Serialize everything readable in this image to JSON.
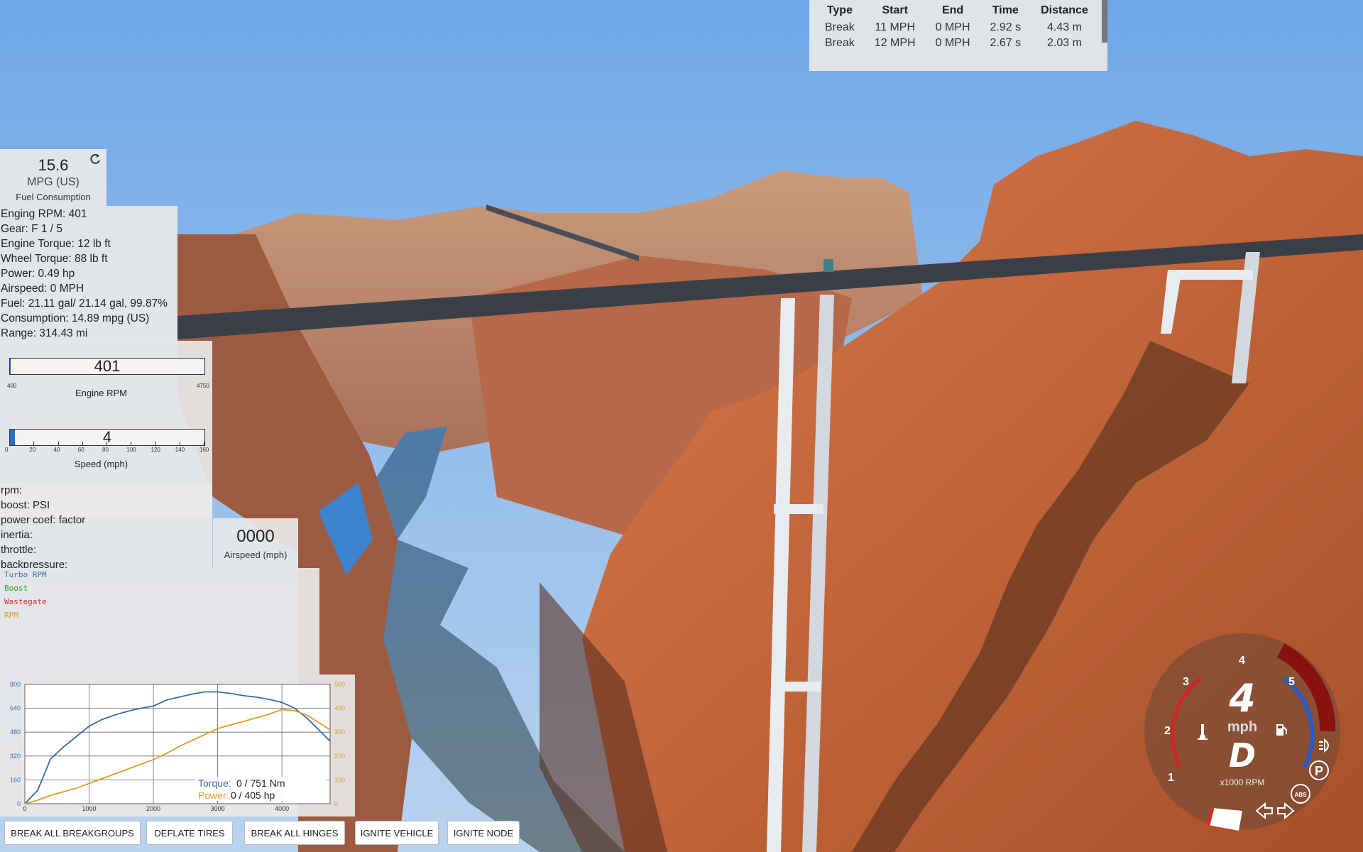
{
  "colors": {
    "sky": "#7fb5ec",
    "rock": "#c9683a",
    "road": "#3a3f47",
    "pillar": "#e8ecef",
    "water": "#4f6e85",
    "accent_blue": "#2a6fc2",
    "torque_line": "#3a6aa8",
    "power_line": "#e39a24"
  },
  "brake_table": {
    "headers": [
      "Type",
      "Start",
      "End",
      "Time",
      "Distance"
    ],
    "rows": [
      [
        "Break",
        "11 MPH",
        "0 MPH",
        "2.92 s",
        "4.43 m"
      ],
      [
        "Break",
        "12 MPH",
        "0 MPH",
        "2.67 s",
        "2.03 m"
      ]
    ]
  },
  "fuel": {
    "value": "15.6",
    "unit": "MPG (US)",
    "label": "Fuel Consumption",
    "refresh_icon": "refresh-icon"
  },
  "stats": [
    "Enging RPM: 401",
    "Gear: F 1 / 5",
    "Engine Torque: 12 lb ft",
    "Wheel Torque: 88 lb ft",
    "Power: 0.49 hp",
    "Airspeed: 0 MPH",
    "Fuel: 21.11 gal/ 21.14 gal, 99.87%",
    "Consumption: 14.89 mpg (US)",
    "Range: 314.43 mi"
  ],
  "rpm_gauge": {
    "value": "401",
    "min": "400",
    "max": "4750",
    "label": "Engine RPM",
    "fill": 0.001
  },
  "speed_gauge": {
    "value": "4",
    "label": "Speed (mph)",
    "ticks": [
      "0",
      "20",
      "40",
      "60",
      "80",
      "100",
      "120",
      "140",
      "160"
    ],
    "fill": 0.025
  },
  "turbo": [
    "rpm:",
    "boost: PSI",
    "power coef: factor",
    "inertia:",
    "throttle:",
    "backpressure:"
  ],
  "airspeed": {
    "value": "0000",
    "label": "Airspeed (mph)"
  },
  "turbo_legend": [
    {
      "name": "Turbo RPM",
      "color": "#3a6aa8"
    },
    {
      "name": "Boost",
      "color": "#2fa82f"
    },
    {
      "name": "Wastegate",
      "color": "#d62c2c"
    },
    {
      "name": "RPM",
      "color": "#e39a24"
    }
  ],
  "chart_data": {
    "type": "line",
    "x": [
      0,
      200,
      400,
      600,
      800,
      1000,
      1200,
      1400,
      1600,
      1800,
      2000,
      2200,
      2400,
      2600,
      2800,
      3000,
      3200,
      3400,
      3600,
      3800,
      4000,
      4200,
      4400,
      4750
    ],
    "xlim": [
      0,
      4750
    ],
    "x_ticks": [
      "0",
      "1000",
      "2000",
      "3000",
      "4000"
    ],
    "y_left_ticks": [
      "0",
      "160",
      "320",
      "480",
      "640",
      "800"
    ],
    "y_right_ticks": [
      "0",
      "100",
      "200",
      "300",
      "400",
      "500"
    ],
    "ylim_left": [
      0,
      800
    ],
    "ylim_right": [
      0,
      500
    ],
    "grid": true,
    "series": [
      {
        "name": "Torque",
        "axis": "left",
        "color": "#3a6aa8",
        "values": [
          0,
          90,
          300,
          380,
          450,
          520,
          565,
          595,
          620,
          640,
          655,
          695,
          715,
          735,
          750,
          750,
          740,
          725,
          715,
          700,
          680,
          640,
          570,
          420
        ]
      },
      {
        "name": "Power",
        "axis": "right",
        "color": "#e39a24",
        "values": [
          0,
          15,
          35,
          50,
          65,
          85,
          105,
          125,
          145,
          165,
          185,
          210,
          240,
          265,
          290,
          315,
          330,
          345,
          360,
          375,
          395,
          390,
          370,
          310
        ]
      }
    ],
    "legend_placement": "bottom-right",
    "readout": {
      "torque_label": "Torque:",
      "torque_value": "0 / 751 Nm",
      "power_label": "Power:",
      "power_value": "0 / 405 hp"
    }
  },
  "buttons": [
    "BREAK ALL BREAKGROUPS",
    "DEFLATE TIRES",
    "BREAK ALL HINGES",
    "IGNITE VEHICLE",
    "IGNITE NODE"
  ],
  "hud": {
    "speed": "4",
    "speed_unit": "mph",
    "gear": "D",
    "rpm_unit": "x1000 RPM",
    "rpm_ticks": [
      "1",
      "2",
      "3",
      "4",
      "5"
    ],
    "icons": [
      "temperature-icon",
      "fuel-pump-icon",
      "headlight-icon",
      "parking-brake-icon",
      "abs-icon",
      "left-signal-icon",
      "right-signal-icon"
    ],
    "parking_label": "P",
    "abs_label": "ABS"
  }
}
